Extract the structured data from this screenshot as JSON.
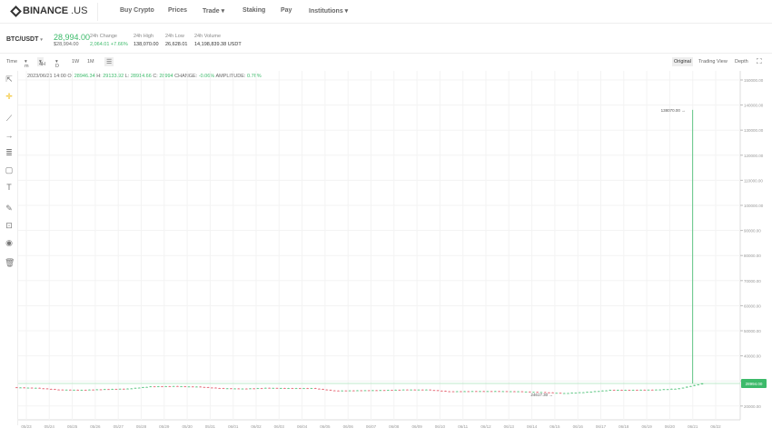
{
  "header": {
    "logo": "BINANCE",
    "logo_suffix": ".US",
    "nav": [
      "Buy Crypto",
      "Prices",
      "Trade",
      "Staking",
      "Pay",
      "Institutions"
    ]
  },
  "ticker": {
    "pair": "BTC/USDT",
    "price": "28,994.00",
    "price_usd": "$28,994.00",
    "change_label": "24h Change",
    "change": "2,064.01 +7.66%",
    "high_label": "24h High",
    "high": "138,070.00",
    "low_label": "24h Low",
    "low": "26,628.01",
    "volume_label": "24h Volume",
    "volume": "14,198,839.38 USDT"
  },
  "toolbar": {
    "time": "Time",
    "intervals": [
      "m",
      "4H",
      "D",
      "1W",
      "1M"
    ],
    "active_interval": "4H",
    "views": [
      "Original",
      "Trading View",
      "Depth"
    ],
    "active_view": "Original"
  },
  "ohlc": {
    "date": "2023/06/21 14:00",
    "o_label": "O:",
    "o": "28946.34",
    "h_label": "H:",
    "h": "29133.92",
    "l_label": "L:",
    "l": "28914.66",
    "c_label": "C:",
    "c": "28994",
    "change_label": "CHANGE:",
    "change": "-0.06%",
    "amp_label": "AMPLITUDE:",
    "amp": "0.76%"
  },
  "colors": {
    "up": "#3cba6a",
    "down": "#e04a5a"
  },
  "chart_data": {
    "type": "candlestick",
    "x": [
      "05/23",
      "05/24",
      "05/25",
      "05/26",
      "05/27",
      "05/28",
      "05/29",
      "05/30",
      "05/31",
      "06/01",
      "06/02",
      "06/03",
      "06/04",
      "06/05",
      "06/06",
      "06/07",
      "06/08",
      "06/09",
      "06/10",
      "06/11",
      "06/12",
      "06/13",
      "06/14",
      "06/15",
      "06/16",
      "06/17",
      "06/18",
      "06/19",
      "06/20",
      "06/21",
      "06/22"
    ],
    "close": [
      27200,
      26500,
      26400,
      26700,
      26900,
      27800,
      27900,
      27700,
      27100,
      26900,
      27200,
      27100,
      27100,
      26100,
      26200,
      26300,
      26500,
      26500,
      25800,
      25900,
      25900,
      25800,
      25500,
      25100,
      25600,
      26400,
      26400,
      26500,
      27000,
      28994,
      null
    ],
    "yticks": [
      150000,
      140000,
      130000,
      120000,
      110000,
      100000,
      90000,
      80000,
      70000,
      60000,
      50000,
      40000,
      30000,
      20000
    ],
    "ylim": [
      14000,
      153000
    ],
    "annotations": {
      "high": "138070.00",
      "low": "24617.30",
      "last": "28994.00"
    },
    "high_value": 138070,
    "low_value": 24617.3,
    "last_value": 28994
  }
}
